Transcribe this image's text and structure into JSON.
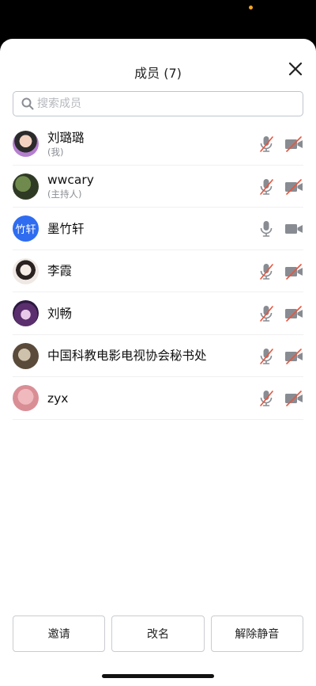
{
  "header": {
    "title": "成员 (7)"
  },
  "search": {
    "placeholder": "搜索成员"
  },
  "members": [
    {
      "name": "刘璐璐",
      "role": "(我)",
      "avatar_text": "",
      "muted": true,
      "video_off": true
    },
    {
      "name": "wwcary",
      "role": "(主持人)",
      "avatar_text": "",
      "muted": true,
      "video_off": true
    },
    {
      "name": "墨竹轩",
      "role": "",
      "avatar_text": "竹轩",
      "muted": false,
      "video_off": false
    },
    {
      "name": "李霞",
      "role": "",
      "avatar_text": "",
      "muted": true,
      "video_off": true
    },
    {
      "name": "刘畅",
      "role": "",
      "avatar_text": "",
      "muted": true,
      "video_off": true
    },
    {
      "name": "中国科教电影电视协会秘书处",
      "role": "",
      "avatar_text": "",
      "muted": true,
      "video_off": true
    },
    {
      "name": "zyx",
      "role": "",
      "avatar_text": "",
      "muted": true,
      "video_off": true
    }
  ],
  "footer": {
    "invite_label": "邀请",
    "rename_label": "改名",
    "unmute_label": "解除静音"
  },
  "colors": {
    "accent": "#2f6cf0",
    "muted_slash": "#e8553e",
    "icon_gray": "#888c92"
  },
  "icons": {
    "close": "close-icon",
    "search": "search-icon",
    "mic": "microphone-icon",
    "cam": "video-camera-icon"
  }
}
